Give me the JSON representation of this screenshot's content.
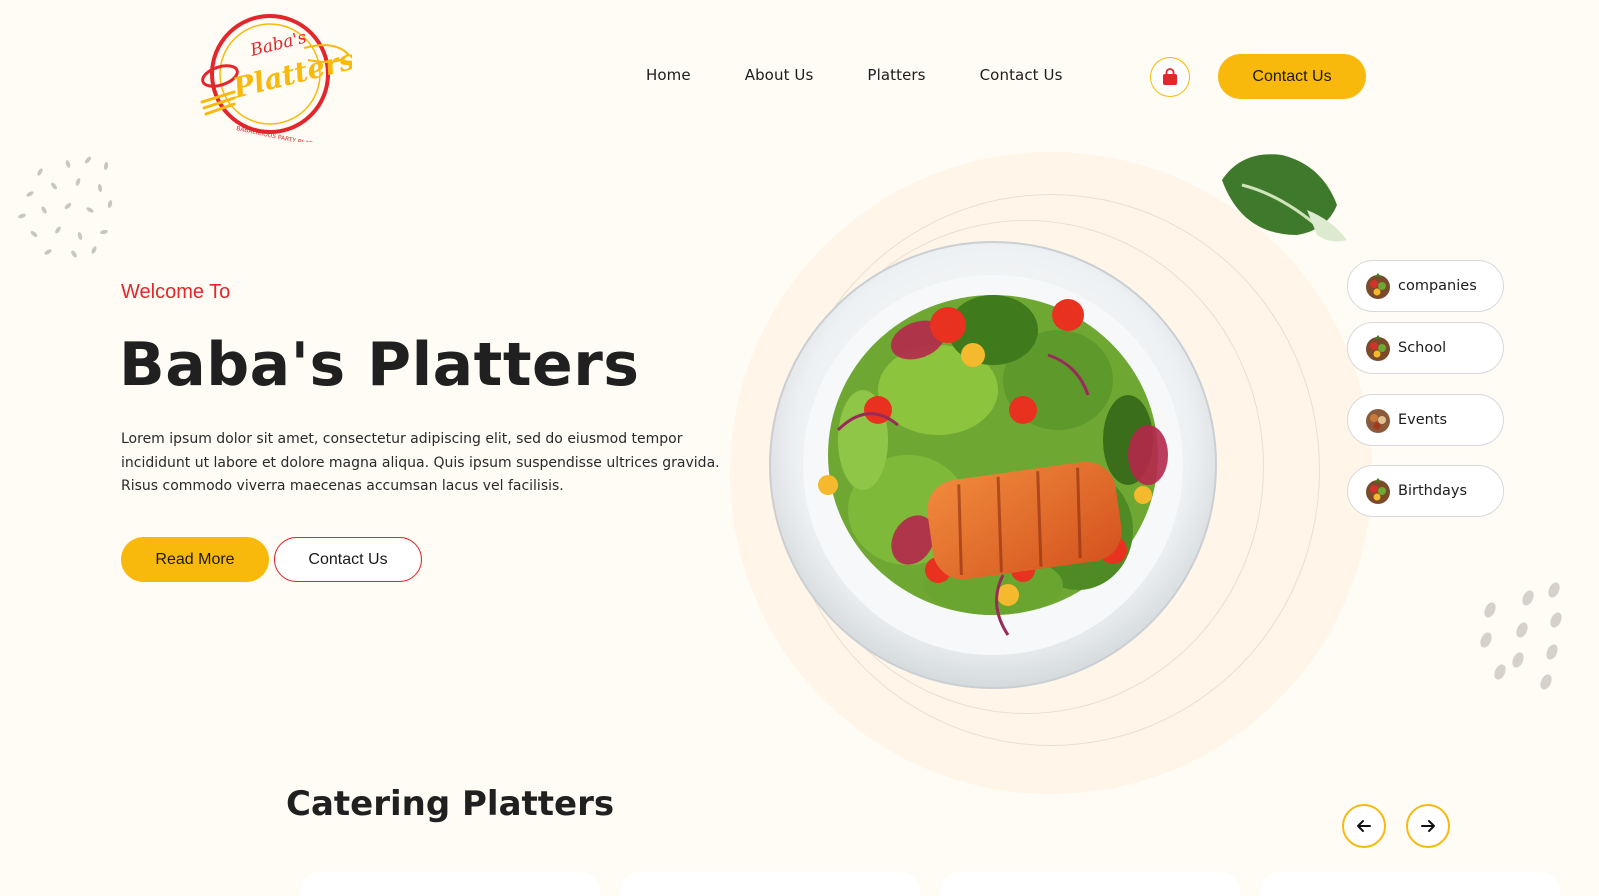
{
  "header": {
    "logo_text": {
      "top": "Baba's",
      "main": "Platters",
      "tagline": "BABALICIOUS PARTY PLATTERS"
    },
    "nav": [
      {
        "label": "Home"
      },
      {
        "label": "About Us"
      },
      {
        "label": "Platters"
      },
      {
        "label": "Contact Us"
      }
    ],
    "cart_icon": "shopping-bag-icon",
    "contact_label": "Contact Us"
  },
  "hero": {
    "welcome": "Welcome To",
    "title": "Baba's Platters",
    "description": "Lorem ipsum dolor sit amet, consectetur adipiscing elit, sed do eiusmod tempor incididunt ut labore et dolore magna aliqua. Quis ipsum suspendisse ultrices gravida. Risus commodo viverra maecenas accumsan lacus vel facilisis.",
    "read_more_label": "Read More",
    "contact_label": "Contact Us",
    "image": "salmon-salad-plate",
    "categories": [
      {
        "label": "companies",
        "icon": "platter-icon"
      },
      {
        "label": "School",
        "icon": "platter-icon"
      },
      {
        "label": "Events",
        "icon": "platter-icon"
      },
      {
        "label": "Birthdays",
        "icon": "platter-icon"
      }
    ]
  },
  "section": {
    "title": "Catering Platters",
    "prev_icon": "arrow-left-icon",
    "next_icon": "arrow-right-icon"
  },
  "colors": {
    "accent_yellow": "#f9b90c",
    "accent_red": "#e3262b",
    "background": "#fffbf5"
  }
}
